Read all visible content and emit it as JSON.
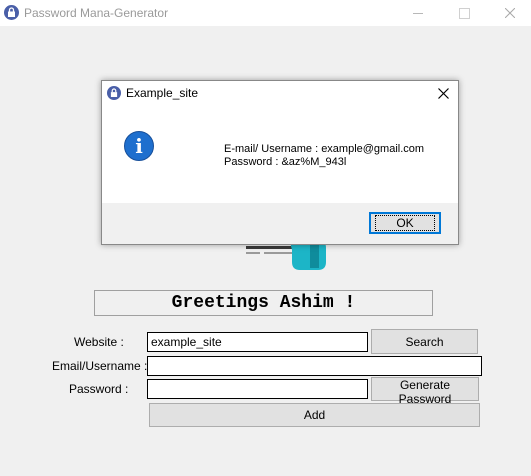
{
  "window": {
    "title": "Password Mana-Generator",
    "icon": "lock-icon"
  },
  "greeting": "Greetings Ashim !",
  "form": {
    "website_label": "Website :",
    "website_value": "example_site",
    "email_label": "Email/Username :",
    "email_value": "",
    "password_label": "Password :",
    "password_value": "",
    "search_label": "Search",
    "generate_label": "Generate Password",
    "add_label": "Add"
  },
  "dialog": {
    "title": "Example_site",
    "icon": "info-icon",
    "line1": "E-mail/ Username : example@gmail.com",
    "line2": "Password : &az%M_943l",
    "ok_label": "OK"
  },
  "colors": {
    "accent": "#0078d7",
    "info_blue": "#1e6fce",
    "logo_teal": "#1cb5c7"
  }
}
